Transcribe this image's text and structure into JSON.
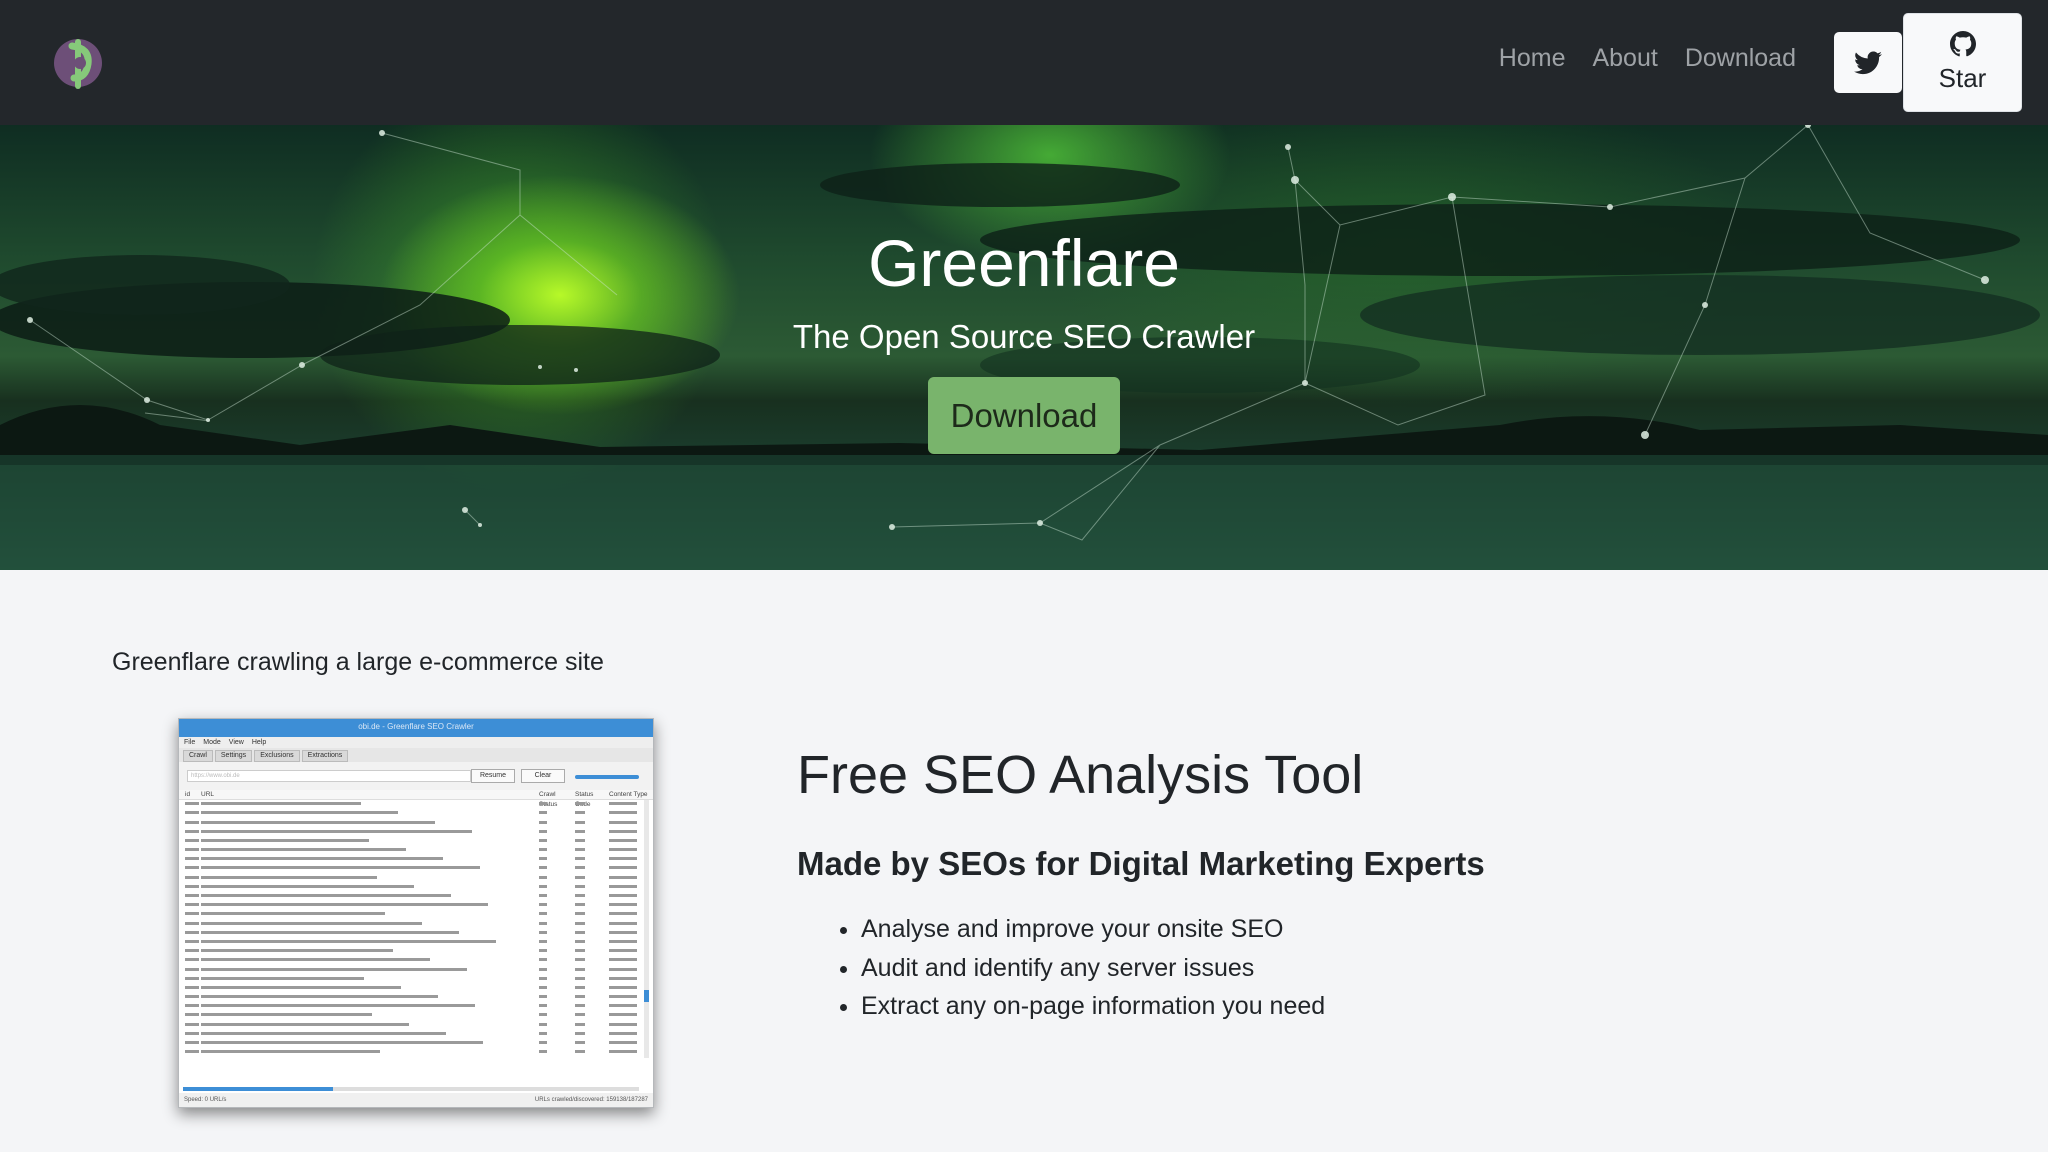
{
  "nav": {
    "links": [
      "Home",
      "About",
      "Download"
    ],
    "twitter_icon": "twitter-icon",
    "github_icon": "github-icon",
    "star_label": "Star"
  },
  "hero": {
    "title": "Greenflare",
    "subtitle": "The Open Source SEO Crawler",
    "download_label": "Download"
  },
  "screenshot": {
    "caption": "Greenflare crawling a large e-commerce site",
    "window_title": "obi.de - Greenflare SEO Crawler",
    "menu": [
      "File",
      "Mode",
      "View",
      "Help"
    ],
    "tabs": [
      "Crawl",
      "Settings",
      "Exclusions",
      "Extractions"
    ],
    "url_placeholder": "https://www.obi.de",
    "buttons": [
      "Resume",
      "Clear"
    ],
    "columns": [
      "id",
      "URL",
      "Crawl Status",
      "Status Code",
      "Content Type"
    ],
    "status_left": "Speed: 0 URL/s",
    "status_right": "URLs crawled/discovered: 159138/187287"
  },
  "features": {
    "title": "Free SEO Analysis Tool",
    "subtitle": "Made by SEOs for Digital Marketing Experts",
    "items": [
      "Analyse and improve your onsite SEO",
      "Audit and identify any server issues",
      "Extract any on-page information you need"
    ]
  },
  "colors": {
    "navbar": "#23272b",
    "accent_green": "#79b46c",
    "page_bg": "#f4f5f7"
  }
}
